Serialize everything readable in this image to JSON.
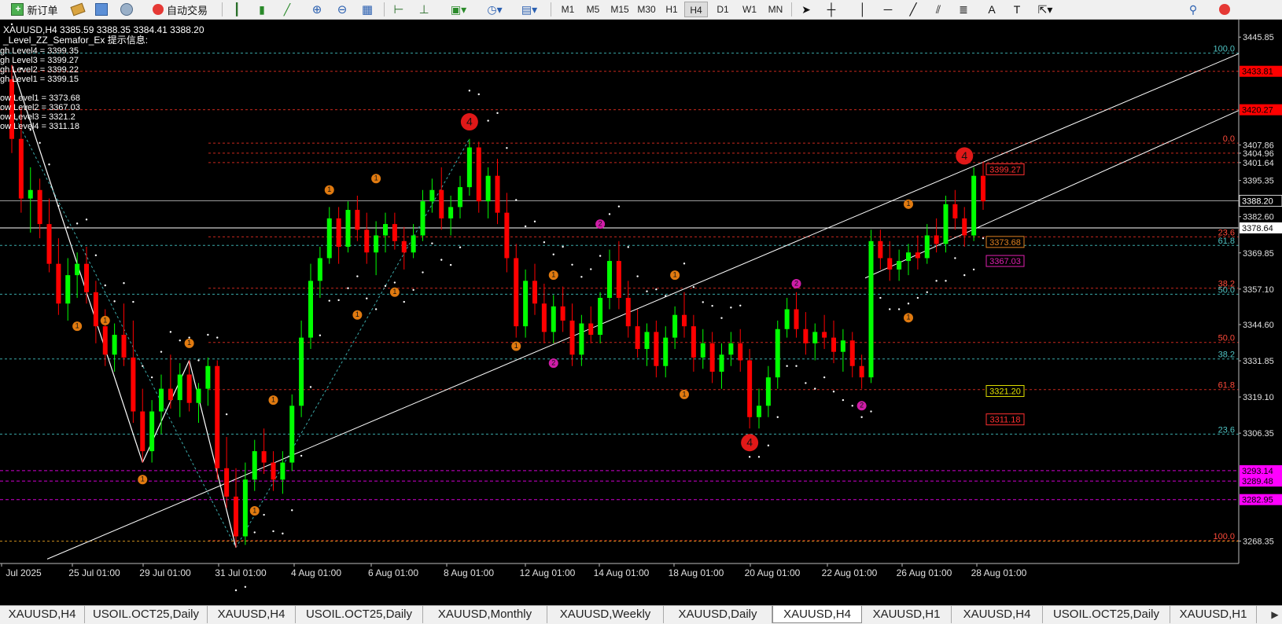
{
  "toolbar": {
    "new_order": "新订单",
    "auto_trading": "自动交易",
    "timeframes": [
      "M1",
      "M5",
      "M15",
      "M30",
      "H1",
      "H4",
      "D1",
      "W1",
      "MN"
    ],
    "active_timeframe": "H4"
  },
  "chart_data": {
    "type": "candlestick",
    "symbol_line": "XAUUSD,H4  3385.59 3388.35 3384.41 3388.20",
    "indicator_title": "_Level_ZZ_Semafor_Ex 提示信息:",
    "info_lines": [
      "gh Level4 = 3399.35",
      "gh Level3 = 3399.27",
      "gh Level2 = 3399.22",
      "gh Level1 = 3399.15",
      "",
      "ow Level1 = 3373.68",
      "ow Level2 = 3367.03",
      "ow Level3 = 3321.2",
      "ow Level4 = 3311.18"
    ],
    "ylim": [
      3261,
      3452
    ],
    "price_ticks": [
      "3445.85",
      "3433.81",
      "3420.27",
      "3407.86",
      "3404.96",
      "3401.64",
      "3395.35",
      "3388.20",
      "3382.60",
      "3378.64",
      "3369.85",
      "3357.10",
      "3344.60",
      "3331.85",
      "3319.10",
      "3306.35",
      "3293.14",
      "3289.48",
      "3282.95",
      "3268.35"
    ],
    "current_price": "3388.20",
    "level_labels": [
      {
        "text": "3433.81",
        "value": 3433.81,
        "color": "#ff0000"
      },
      {
        "text": "3420.27",
        "value": 3420.27,
        "color": "#ff0000"
      },
      {
        "text": "3378.64",
        "value": 3378.64,
        "color": "#ffffff"
      },
      {
        "text": "3293.14",
        "value": 3293.14,
        "color": "#ff00ff"
      },
      {
        "text": "3289.48",
        "value": 3289.48,
        "color": "#ff00ff"
      },
      {
        "text": "3282.95",
        "value": 3282.95,
        "color": "#ff00ff"
      }
    ],
    "fib_labels": [
      {
        "text": "100.0",
        "value": 3440.2,
        "color": "#4fc3c3"
      },
      {
        "text": "0.0",
        "value": 3408.5,
        "color": "#ff4a3a"
      },
      {
        "text": "23.6",
        "value": 3375.5,
        "color": "#ff4a3a"
      },
      {
        "text": "61.8",
        "value": 3372.5,
        "color": "#4fc3c3"
      },
      {
        "text": "38.2",
        "value": 3357.4,
        "color": "#ff4a3a"
      },
      {
        "text": "50.0",
        "value": 3355.3,
        "color": "#4fc3c3"
      },
      {
        "text": "50.0",
        "value": 3338.3,
        "color": "#ff4a3a"
      },
      {
        "text": "38.2",
        "value": 3332.5,
        "color": "#4fc3c3"
      },
      {
        "text": "61.8",
        "value": 3321.7,
        "color": "#ff4a3a"
      },
      {
        "text": "23.6",
        "value": 3306.0,
        "color": "#4fc3c3"
      },
      {
        "text": "100.0",
        "value": 3268.5,
        "color": "#ff4a3a"
      }
    ],
    "semafor_boxes": [
      {
        "text": "3399.27",
        "value": 3399.3,
        "color": "#ff3030"
      },
      {
        "text": "3373.68",
        "value": 3373.7,
        "color": "#e08020"
      },
      {
        "text": "3367.03",
        "value": 3367.0,
        "color": "#e020b0"
      },
      {
        "text": "3321.20",
        "value": 3321.2,
        "color": "#e0e000"
      },
      {
        "text": "3311.18",
        "value": 3311.2,
        "color": "#ff3030"
      }
    ],
    "x_labels": [
      "Jul 2025",
      "25 Jul 01:00",
      "29 Jul 01:00",
      "31 Jul 01:00",
      "4 Aug 01:00",
      "6 Aug 01:00",
      "8 Aug 01:00",
      "12 Aug 01:00",
      "14 Aug 01:00",
      "18 Aug 01:00",
      "20 Aug 01:00",
      "22 Aug 01:00",
      "26 Aug 01:00",
      "28 Aug 01:00"
    ],
    "candles": [
      [
        3431,
        3436,
        3405,
        3410
      ],
      [
        3410,
        3421,
        3384,
        3389
      ],
      [
        3389,
        3400,
        3377,
        3392
      ],
      [
        3392,
        3396,
        3375,
        3380
      ],
      [
        3380,
        3389,
        3363,
        3366
      ],
      [
        3366,
        3375,
        3348,
        3352
      ],
      [
        3352,
        3368,
        3346,
        3362
      ],
      [
        3362,
        3370,
        3354,
        3366
      ],
      [
        3366,
        3372,
        3352,
        3356
      ],
      [
        3356,
        3360,
        3338,
        3344
      ],
      [
        3344,
        3350,
        3330,
        3334
      ],
      [
        3334,
        3345,
        3328,
        3341
      ],
      [
        3341,
        3352,
        3330,
        3333
      ],
      [
        3333,
        3346,
        3310,
        3314
      ],
      [
        3314,
        3322,
        3296,
        3300
      ],
      [
        3300,
        3318,
        3296,
        3314
      ],
      [
        3314,
        3327,
        3306,
        3322
      ],
      [
        3322,
        3334,
        3315,
        3318
      ],
      [
        3318,
        3331,
        3312,
        3327
      ],
      [
        3327,
        3332,
        3314,
        3317
      ],
      [
        3317,
        3324,
        3310,
        3322
      ],
      [
        3322,
        3333,
        3316,
        3330
      ],
      [
        3330,
        3332,
        3290,
        3294
      ],
      [
        3294,
        3305,
        3280,
        3284
      ],
      [
        3284,
        3294,
        3266,
        3270
      ],
      [
        3270,
        3296,
        3267,
        3290
      ],
      [
        3290,
        3304,
        3286,
        3300
      ],
      [
        3300,
        3308,
        3292,
        3296
      ],
      [
        3296,
        3300,
        3286,
        3290
      ],
      [
        3290,
        3300,
        3285,
        3296
      ],
      [
        3296,
        3320,
        3293,
        3316
      ],
      [
        3316,
        3346,
        3312,
        3340
      ],
      [
        3340,
        3366,
        3336,
        3360
      ],
      [
        3360,
        3372,
        3354,
        3368
      ],
      [
        3368,
        3386,
        3366,
        3382
      ],
      [
        3382,
        3386,
        3366,
        3372
      ],
      [
        3372,
        3388,
        3370,
        3385
      ],
      [
        3385,
        3390,
        3374,
        3378
      ],
      [
        3378,
        3384,
        3366,
        3370
      ],
      [
        3370,
        3381,
        3362,
        3376
      ],
      [
        3376,
        3384,
        3370,
        3380
      ],
      [
        3380,
        3384,
        3371,
        3374
      ],
      [
        3374,
        3379,
        3364,
        3370
      ],
      [
        3370,
        3380,
        3368,
        3376
      ],
      [
        3376,
        3392,
        3374,
        3388
      ],
      [
        3388,
        3396,
        3384,
        3392
      ],
      [
        3392,
        3400,
        3378,
        3382
      ],
      [
        3382,
        3390,
        3376,
        3386
      ],
      [
        3386,
        3397,
        3382,
        3393
      ],
      [
        3393,
        3410,
        3390,
        3407
      ],
      [
        3407,
        3409,
        3384,
        3388
      ],
      [
        3388,
        3400,
        3382,
        3397
      ],
      [
        3397,
        3403,
        3380,
        3384
      ],
      [
        3384,
        3391,
        3363,
        3368
      ],
      [
        3368,
        3373,
        3340,
        3344
      ],
      [
        3344,
        3364,
        3340,
        3360
      ],
      [
        3360,
        3366,
        3348,
        3352
      ],
      [
        3352,
        3359,
        3338,
        3342
      ],
      [
        3342,
        3355,
        3338,
        3351
      ],
      [
        3351,
        3358,
        3342,
        3346
      ],
      [
        3346,
        3352,
        3330,
        3334
      ],
      [
        3334,
        3348,
        3330,
        3345
      ],
      [
        3345,
        3351,
        3338,
        3341
      ],
      [
        3341,
        3356,
        3338,
        3354
      ],
      [
        3354,
        3371,
        3350,
        3367
      ],
      [
        3367,
        3374,
        3350,
        3354
      ],
      [
        3354,
        3360,
        3340,
        3344
      ],
      [
        3344,
        3350,
        3333,
        3336
      ],
      [
        3336,
        3345,
        3330,
        3342
      ],
      [
        3342,
        3346,
        3326,
        3330
      ],
      [
        3330,
        3344,
        3326,
        3340
      ],
      [
        3340,
        3351,
        3336,
        3348
      ],
      [
        3348,
        3356,
        3340,
        3344
      ],
      [
        3344,
        3348,
        3328,
        3333
      ],
      [
        3333,
        3343,
        3329,
        3338
      ],
      [
        3338,
        3342,
        3324,
        3328
      ],
      [
        3328,
        3338,
        3322,
        3334
      ],
      [
        3334,
        3342,
        3330,
        3338
      ],
      [
        3338,
        3343,
        3328,
        3332
      ],
      [
        3332,
        3336,
        3308,
        3312
      ],
      [
        3312,
        3322,
        3308,
        3316
      ],
      [
        3316,
        3330,
        3312,
        3326
      ],
      [
        3326,
        3346,
        3322,
        3343
      ],
      [
        3343,
        3354,
        3340,
        3350
      ],
      [
        3350,
        3356,
        3340,
        3343
      ],
      [
        3343,
        3349,
        3334,
        3338
      ],
      [
        3338,
        3345,
        3332,
        3342
      ],
      [
        3342,
        3348,
        3336,
        3340
      ],
      [
        3340,
        3346,
        3331,
        3335
      ],
      [
        3335,
        3343,
        3328,
        3339
      ],
      [
        3339,
        3342,
        3326,
        3330
      ],
      [
        3330,
        3334,
        3322,
        3326
      ],
      [
        3326,
        3378,
        3324,
        3374
      ],
      [
        3374,
        3378,
        3364,
        3368
      ],
      [
        3368,
        3374,
        3360,
        3364
      ],
      [
        3364,
        3371,
        3360,
        3367
      ],
      [
        3367,
        3373,
        3362,
        3370
      ],
      [
        3370,
        3376,
        3364,
        3368
      ],
      [
        3368,
        3380,
        3366,
        3376
      ],
      [
        3376,
        3382,
        3370,
        3373
      ],
      [
        3373,
        3390,
        3370,
        3387
      ],
      [
        3387,
        3392,
        3378,
        3382
      ],
      [
        3382,
        3386,
        3372,
        3376
      ],
      [
        3376,
        3400,
        3374,
        3397
      ],
      [
        3397,
        3402,
        3385,
        3388
      ]
    ]
  },
  "tabs": [
    "XAUUSD,H4",
    "USOIL.OCT25,Daily",
    "XAUUSD,H4",
    "USOIL.OCT25,Daily",
    "XAUUSD,Monthly",
    "XAUUSD,Weekly",
    "XAUUSD,Daily",
    "XAUUSD,H4",
    "XAUUSD,H1",
    "XAUUSD,H4",
    "USOIL.OCT25,Daily",
    "XAUUSD,H1"
  ],
  "active_tab_index": 7,
  "colors": {
    "bull": "#00ff00",
    "bear": "#ff0000",
    "grid_up": "#ff3b30",
    "grid_cyan": "#4fc3c3",
    "wedge": "#ffffff",
    "semafor": "#e07a10"
  }
}
